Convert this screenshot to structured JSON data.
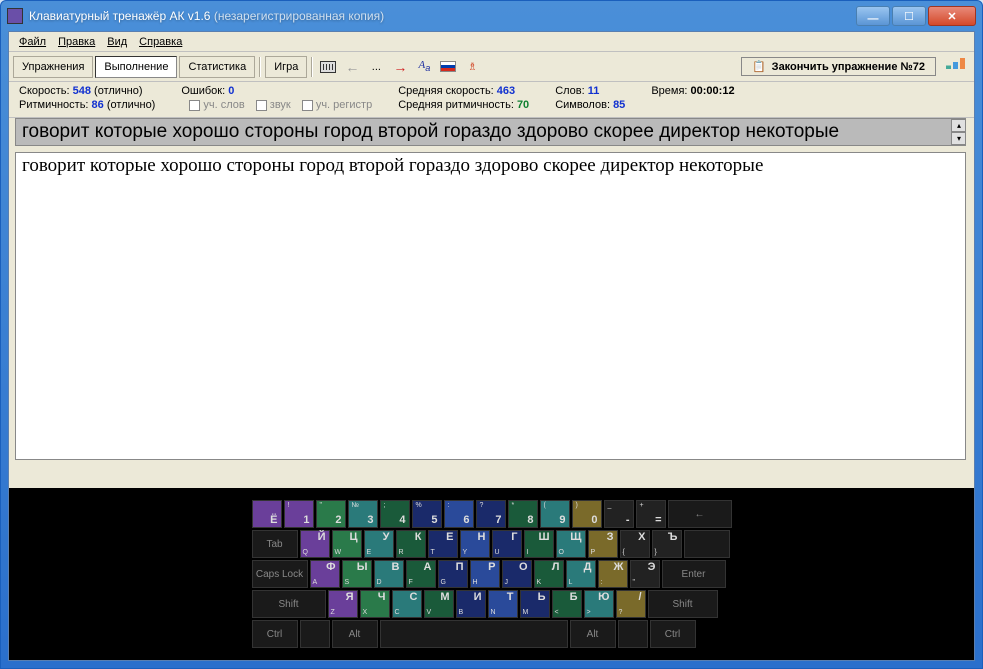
{
  "window": {
    "title": "Клавиатурный тренажёр АК v1.6",
    "subtitle": "(незарегистрированная копия)"
  },
  "menu": {
    "file": "Файл",
    "edit": "Правка",
    "view": "Вид",
    "help": "Справка"
  },
  "toolbar": {
    "exercises": "Упражнения",
    "execution": "Выполнение",
    "statistics": "Статистика",
    "game": "Игра",
    "dots": "...",
    "finish": "Закончить упражнение №72"
  },
  "stats": {
    "speed_label": "Скорость:",
    "speed_val": "548",
    "speed_rating": "(отлично)",
    "rhythm_label": "Ритмичность:",
    "rhythm_val": "86",
    "rhythm_rating": "(отлично)",
    "errors_label": "Ошибок:",
    "errors_val": "0",
    "chk_words": "уч. слов",
    "chk_sound": "звук",
    "chk_case": "уч. регистр",
    "avg_speed_label": "Средняя скорость:",
    "avg_speed_val": "463",
    "avg_rhythm_label": "Средняя ритмичность:",
    "avg_rhythm_val": "70",
    "words_label": "Слов:",
    "words_val": "11",
    "chars_label": "Символов:",
    "chars_val": "85",
    "time_label": "Время:",
    "time_val": "00:00:12"
  },
  "text": {
    "target": "говорит которые хорошо стороны город второй гораздо здорово скорее директор некоторые",
    "typed": "говорит которые хорошо стороны город второй гораздо здорово скорее директор некоторые"
  },
  "keyboard": {
    "row1": [
      {
        "top": "",
        "main": "Ё",
        "c": "c-purple"
      },
      {
        "top": "!",
        "main": "1",
        "c": "c-purple"
      },
      {
        "top": "\"",
        "main": "2",
        "c": "c-green"
      },
      {
        "top": "№",
        "main": "3",
        "c": "c-teal"
      },
      {
        "top": ";",
        "main": "4",
        "c": "c-dgreen"
      },
      {
        "top": "%",
        "main": "5",
        "c": "c-navy"
      },
      {
        "top": ":",
        "main": "6",
        "c": "c-blue"
      },
      {
        "top": "?",
        "main": "7",
        "c": "c-navy"
      },
      {
        "top": "*",
        "main": "8",
        "c": "c-dgreen"
      },
      {
        "top": "(",
        "main": "9",
        "c": "c-teal"
      },
      {
        "top": ")",
        "main": "0",
        "c": "c-olive"
      },
      {
        "top": "_",
        "main": "-",
        "c": "c-dark"
      },
      {
        "top": "+",
        "main": "=",
        "c": "c-dark"
      }
    ],
    "row2": [
      {
        "sub": "Q",
        "main": "Й",
        "c": "c-purple"
      },
      {
        "sub": "W",
        "main": "Ц",
        "c": "c-green"
      },
      {
        "sub": "E",
        "main": "У",
        "c": "c-teal"
      },
      {
        "sub": "R",
        "main": "К",
        "c": "c-dgreen"
      },
      {
        "sub": "T",
        "main": "Е",
        "c": "c-navy"
      },
      {
        "sub": "Y",
        "main": "Н",
        "c": "c-blue"
      },
      {
        "sub": "U",
        "main": "Г",
        "c": "c-navy"
      },
      {
        "sub": "I",
        "main": "Ш",
        "c": "c-dgreen"
      },
      {
        "sub": "O",
        "main": "Щ",
        "c": "c-teal"
      },
      {
        "sub": "P",
        "main": "З",
        "c": "c-olive"
      },
      {
        "sub": "{",
        "main": "Х",
        "c": "c-dark"
      },
      {
        "sub": "}",
        "main": "Ъ",
        "c": "c-dark"
      }
    ],
    "row3": [
      {
        "sub": "A",
        "main": "Ф",
        "c": "c-purple"
      },
      {
        "sub": "S",
        "main": "Ы",
        "c": "c-green"
      },
      {
        "sub": "D",
        "main": "В",
        "c": "c-teal"
      },
      {
        "sub": "F",
        "main": "А",
        "c": "c-dgreen"
      },
      {
        "sub": "G",
        "main": "П",
        "c": "c-navy"
      },
      {
        "sub": "H",
        "main": "Р",
        "c": "c-blue"
      },
      {
        "sub": "J",
        "main": "О",
        "c": "c-navy"
      },
      {
        "sub": "K",
        "main": "Л",
        "c": "c-dgreen"
      },
      {
        "sub": "L",
        "main": "Д",
        "c": "c-teal"
      },
      {
        "sub": ":",
        "main": "Ж",
        "c": "c-olive"
      },
      {
        "sub": "\"",
        "main": "Э",
        "c": "c-dark"
      }
    ],
    "row4": [
      {
        "sub": "Z",
        "main": "Я",
        "c": "c-purple"
      },
      {
        "sub": "X",
        "main": "Ч",
        "c": "c-green"
      },
      {
        "sub": "C",
        "main": "С",
        "c": "c-teal"
      },
      {
        "sub": "V",
        "main": "М",
        "c": "c-dgreen"
      },
      {
        "sub": "B",
        "main": "И",
        "c": "c-navy"
      },
      {
        "sub": "N",
        "main": "Т",
        "c": "c-blue"
      },
      {
        "sub": "M",
        "main": "Ь",
        "c": "c-navy"
      },
      {
        "sub": "<",
        "main": "Б",
        "c": "c-dgreen"
      },
      {
        "sub": ">",
        "main": "Ю",
        "c": "c-teal"
      },
      {
        "sub": "?",
        "main": "/",
        "c": "c-olive"
      }
    ],
    "func": {
      "tab": "Tab",
      "caps": "Caps Lock",
      "enter": "Enter",
      "shift": "Shift",
      "ctrl": "Ctrl",
      "alt": "Alt",
      "backspace": "←"
    }
  }
}
